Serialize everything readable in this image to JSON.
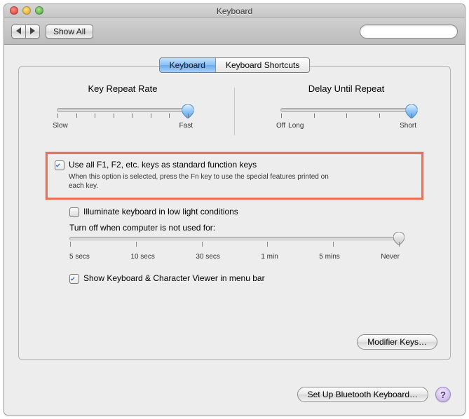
{
  "window": {
    "title": "Keyboard"
  },
  "toolbar": {
    "showAll": "Show All",
    "search": {
      "value": ""
    }
  },
  "tabs": {
    "keyboard": "Keyboard",
    "shortcuts": "Keyboard Shortcuts"
  },
  "sliders": {
    "repeat": {
      "title": "Key Repeat Rate",
      "min": "Slow",
      "max": "Fast",
      "ticks": 8,
      "valueIndex": 7
    },
    "delay": {
      "title": "Delay Until Repeat",
      "off": "Off",
      "min": "Long",
      "max": "Short",
      "ticks": 5,
      "valueIndex": 4
    }
  },
  "options": {
    "fn": {
      "checked": true,
      "label": "Use all F1, F2, etc. keys as standard function keys",
      "desc": "When this option is selected, press the Fn key to use the special features printed on each key."
    },
    "illuminate": {
      "checked": false,
      "label": "Illuminate keyboard in low light conditions"
    },
    "turnoff": {
      "label": "Turn off when computer is not used for:",
      "marks": [
        "5 secs",
        "10 secs",
        "30 secs",
        "1 min",
        "5 mins",
        "Never"
      ],
      "valueIndex": 5
    },
    "showViewer": {
      "checked": true,
      "label": "Show Keyboard & Character Viewer in menu bar"
    }
  },
  "buttons": {
    "modifier": "Modifier Keys…",
    "bluetooth": "Set Up Bluetooth Keyboard…",
    "help": "?"
  }
}
